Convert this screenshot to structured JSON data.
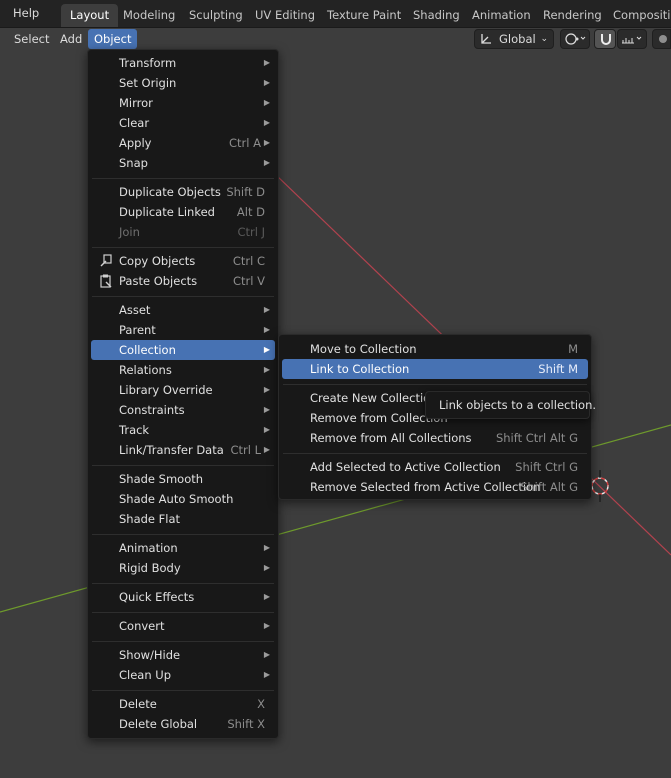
{
  "topbar": {
    "help": "Help",
    "tabs": [
      "Layout",
      "Modeling",
      "Sculpting",
      "UV Editing",
      "Texture Paint",
      "Shading",
      "Animation",
      "Rendering",
      "Compositing"
    ]
  },
  "header": {
    "select": "Select",
    "add": "Add",
    "object": "Object",
    "orientation": "Global"
  },
  "object_menu": {
    "items": [
      {
        "label": "Transform",
        "shortcut": ""
      },
      {
        "label": "Set Origin",
        "shortcut": ""
      },
      {
        "label": "Mirror",
        "shortcut": ""
      },
      {
        "label": "Clear",
        "shortcut": ""
      },
      {
        "label": "Apply",
        "shortcut": "Ctrl A"
      },
      {
        "label": "Snap",
        "shortcut": ""
      },
      {
        "label": "Duplicate Objects",
        "shortcut": "Shift D"
      },
      {
        "label": "Duplicate Linked",
        "shortcut": "Alt D"
      },
      {
        "label": "Join",
        "shortcut": "Ctrl J"
      },
      {
        "label": "Copy Objects",
        "shortcut": "Ctrl C"
      },
      {
        "label": "Paste Objects",
        "shortcut": "Ctrl V"
      },
      {
        "label": "Asset",
        "shortcut": ""
      },
      {
        "label": "Parent",
        "shortcut": ""
      },
      {
        "label": "Collection",
        "shortcut": ""
      },
      {
        "label": "Relations",
        "shortcut": ""
      },
      {
        "label": "Library Override",
        "shortcut": ""
      },
      {
        "label": "Constraints",
        "shortcut": ""
      },
      {
        "label": "Track",
        "shortcut": ""
      },
      {
        "label": "Link/Transfer Data",
        "shortcut": "Ctrl L"
      },
      {
        "label": "Shade Smooth",
        "shortcut": ""
      },
      {
        "label": "Shade Auto Smooth",
        "shortcut": ""
      },
      {
        "label": "Shade Flat",
        "shortcut": ""
      },
      {
        "label": "Animation",
        "shortcut": ""
      },
      {
        "label": "Rigid Body",
        "shortcut": ""
      },
      {
        "label": "Quick Effects",
        "shortcut": ""
      },
      {
        "label": "Convert",
        "shortcut": ""
      },
      {
        "label": "Show/Hide",
        "shortcut": ""
      },
      {
        "label": "Clean Up",
        "shortcut": ""
      },
      {
        "label": "Delete",
        "shortcut": "X"
      },
      {
        "label": "Delete Global",
        "shortcut": "Shift X"
      }
    ]
  },
  "collection_menu": {
    "items": [
      {
        "label": "Move to Collection",
        "shortcut": "M"
      },
      {
        "label": "Link to Collection",
        "shortcut": "Shift M"
      },
      {
        "label": "Create New Collection",
        "shortcut": ""
      },
      {
        "label": "Remove from Collection",
        "shortcut": ""
      },
      {
        "label": "Remove from All Collections",
        "shortcut": "Shift Ctrl Alt G"
      },
      {
        "label": "Add Selected to Active Collection",
        "shortcut": "Shift Ctrl G"
      },
      {
        "label": "Remove Selected from Active Collection",
        "shortcut": "Shift Alt G"
      }
    ]
  },
  "tooltip": "Link objects to a collection.",
  "colors": {
    "highlight": "#4772b3",
    "menu_bg": "#181818",
    "viewport_bg": "#3d3d3d",
    "x_axis": "#b1424e",
    "y_axis": "#6e9a2c"
  }
}
